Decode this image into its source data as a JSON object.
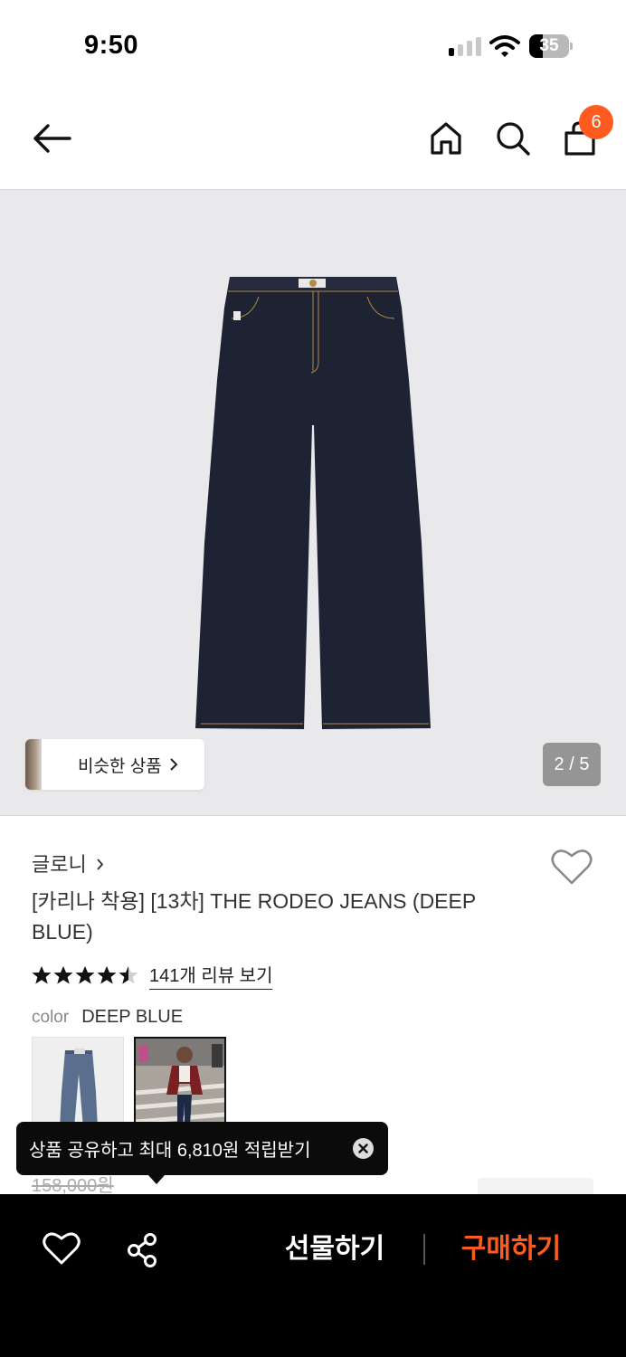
{
  "status_bar": {
    "time": "9:50",
    "battery_percent": "35",
    "battery_level": 0.35,
    "signal_bars_on": 1,
    "signal_bars_total": 4
  },
  "header": {
    "cart_count": "6",
    "icons": [
      "back-arrow-icon",
      "home-icon",
      "search-icon",
      "shopping-bag-icon"
    ]
  },
  "gallery": {
    "similar_label": "비슷한 상품",
    "page_indicator": "2 / 5",
    "current_page": 2,
    "total_pages": 5
  },
  "product": {
    "brand": "글로니",
    "title": "[카리나 착용] [13차] THE RODEO JEANS (DEEP BLUE)",
    "rating": 4.5,
    "review_link": "141개 리뷰 보기",
    "color_label": "color",
    "color_value": "DEEP BLUE",
    "original_price": "158,000원"
  },
  "tooltip": {
    "text": "상품 공유하고 최대 6,810원 적립받기"
  },
  "bottom_bar": {
    "gift_label": "선물하기",
    "buy_label": "구매하기"
  },
  "colors": {
    "accent": "#ff5a1f",
    "denim": "#1e2333",
    "stitch": "#b48a45",
    "image_bg": "#e9e9eb"
  }
}
